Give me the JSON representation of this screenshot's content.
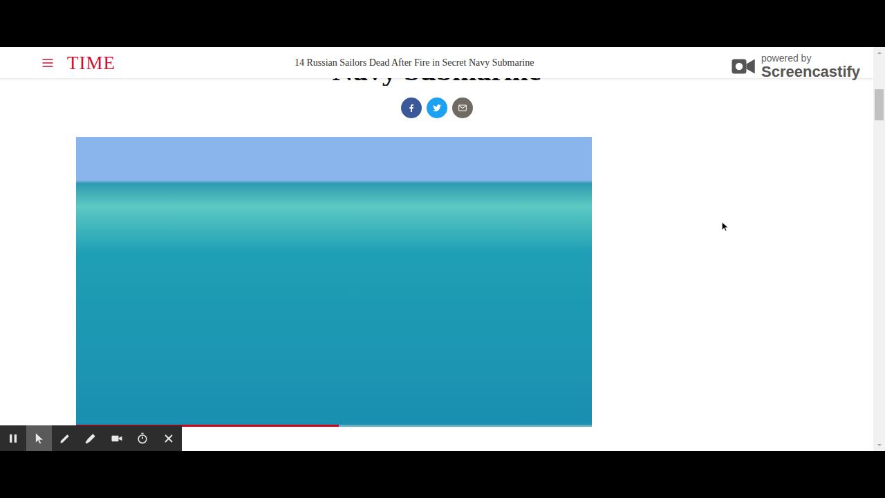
{
  "header": {
    "logo": "TIME",
    "title": "14 Russian Sailors Dead After Fire in Secret Navy Submarine"
  },
  "article": {
    "heading": "Navy Submarine",
    "share": [
      {
        "kind": "facebook",
        "color": "#3b5998"
      },
      {
        "kind": "twitter",
        "color": "#1da1f2"
      },
      {
        "kind": "email",
        "color": "#6f6a62"
      }
    ]
  },
  "video": {
    "level": 0.51
  },
  "watermark": {
    "powered_by": "powered by",
    "brand": "Screencastify"
  },
  "scrollbar": {
    "level": 0.08
  },
  "toolbar": {
    "tools": [
      {
        "kind": "pause",
        "selected": false
      },
      {
        "kind": "pointer",
        "selected": true
      },
      {
        "kind": "pen",
        "selected": false
      },
      {
        "kind": "highlighter",
        "selected": false
      },
      {
        "kind": "camera",
        "selected": false
      },
      {
        "kind": "timer",
        "selected": false
      },
      {
        "kind": "close",
        "selected": false
      }
    ]
  }
}
